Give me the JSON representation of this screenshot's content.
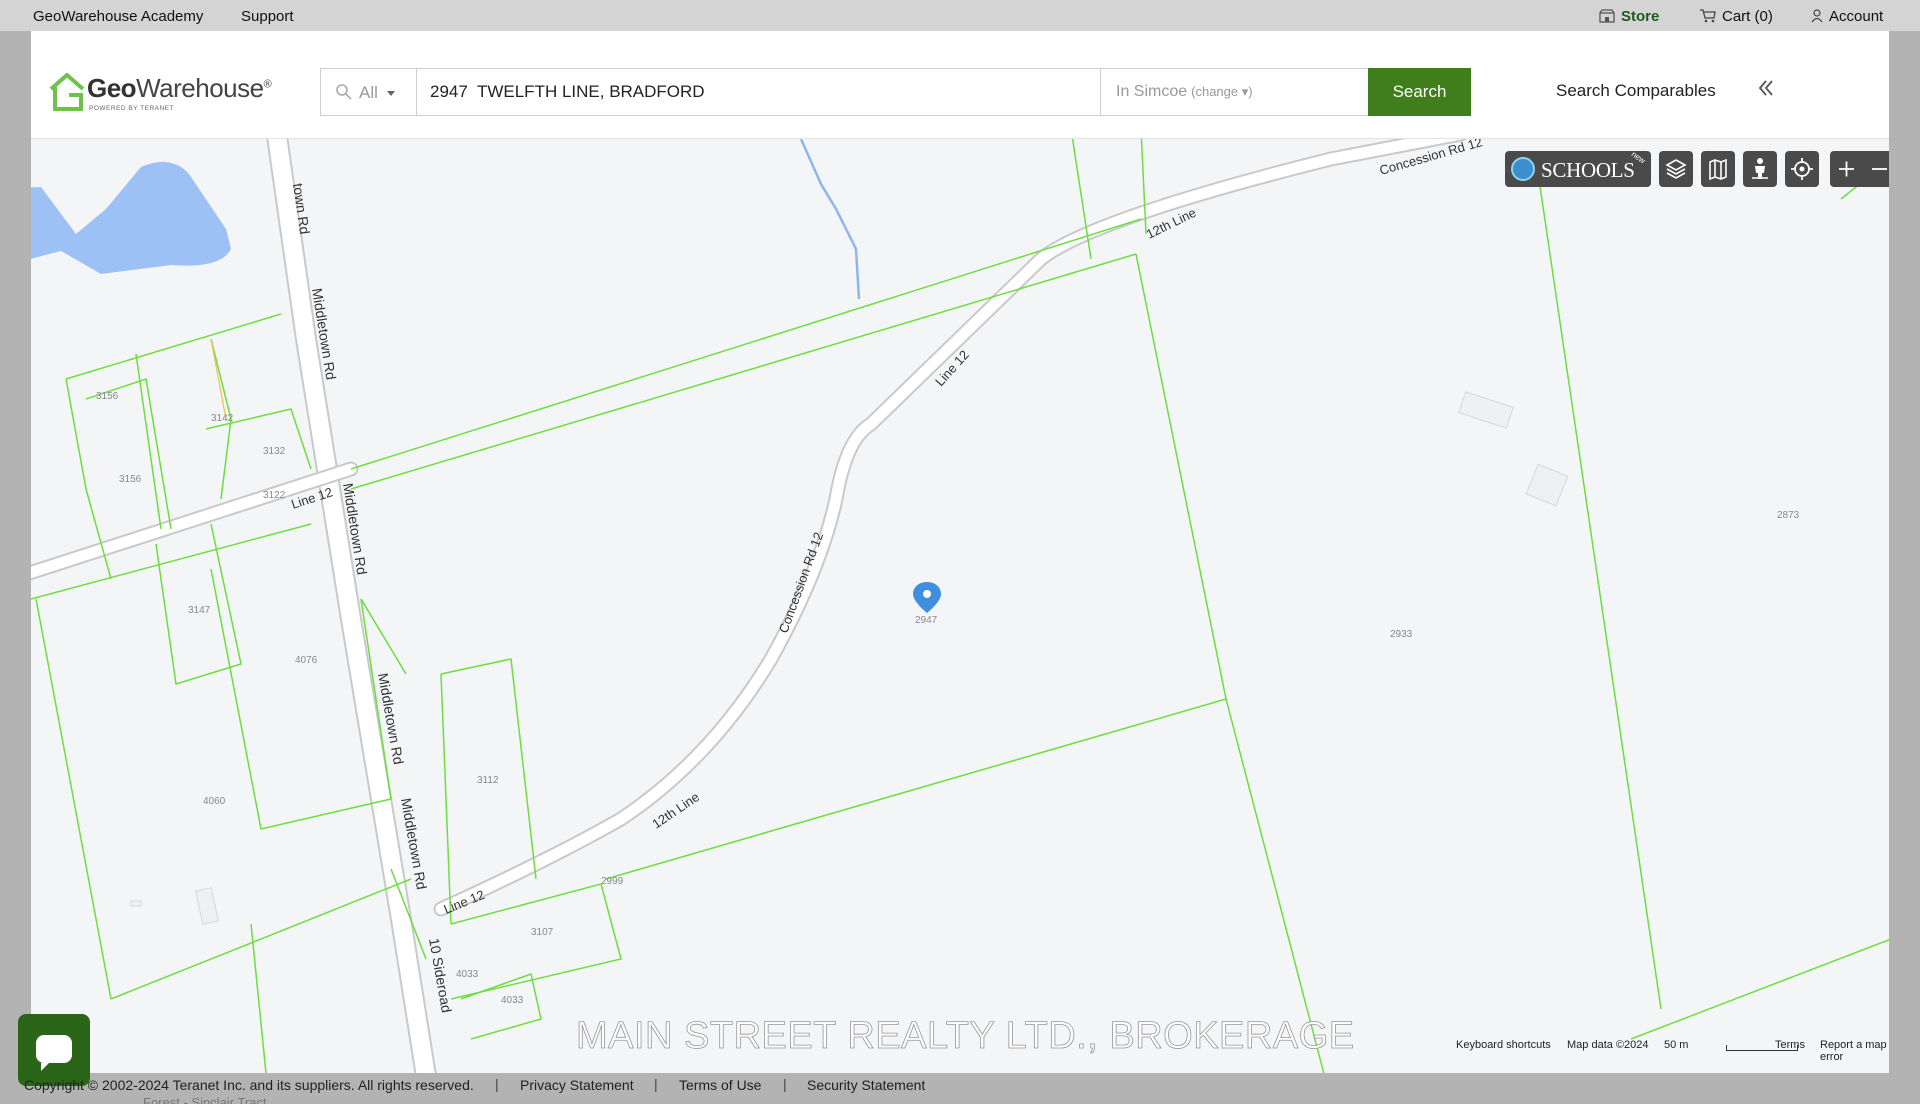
{
  "topbar": {
    "academy": "GeoWarehouse Academy",
    "support": "Support",
    "store": "Store",
    "cart": "Cart (0)",
    "account": "Account"
  },
  "brand": {
    "name_geo": "Geo",
    "name_rest": "Warehouse",
    "registered": "®",
    "tagline": "POWERED BY TERANET",
    "accent": "#6cc24a"
  },
  "search": {
    "scope": "All",
    "value": "2947  TWELFTH LINE, BRADFORD",
    "region": "In Simcoe",
    "change": "(change ▾)",
    "button": "Search",
    "button_color": "#3f7e1a",
    "comparables": "Search Comparables"
  },
  "map": {
    "road_labels": [
      "town Rd",
      "Middletown Rd",
      "Middletown Rd",
      "Middletown Rd",
      "Middletown Rd",
      "10 Sideroad",
      "Line 12",
      "Line 12",
      "Line 12",
      "12th Line",
      "12th Line",
      "Concession Rd 12",
      "Concession Rd 12"
    ],
    "parcel_labels": [
      "3156",
      "3142",
      "3132",
      "3156",
      "3122",
      "3147",
      "4076",
      "4060",
      "3112",
      "2999",
      "3107",
      "4033",
      "4033",
      "2933",
      "2873"
    ],
    "pin_label": "2947",
    "schools": "SCHOOLS",
    "schools_badge": "new",
    "footer": {
      "shortcuts": "Keyboard shortcuts",
      "map_data": "Map data ©2024",
      "scale": "50 m",
      "terms": "Terms",
      "report": "Report a map error"
    },
    "watermark": "MAIN STREET REALTY LTD., BROKERAGE",
    "parcel_color": "#6dde3f",
    "water_color": "#9ec1f5"
  },
  "footer": {
    "copyright": "Copyright © 2002-2024 Teranet Inc. and its suppliers. All rights reserved.",
    "privacy": "Privacy Statement",
    "terms": "Terms of Use",
    "security": "Security Statement",
    "ghost_text": "Forest - Sinclair Tract"
  }
}
